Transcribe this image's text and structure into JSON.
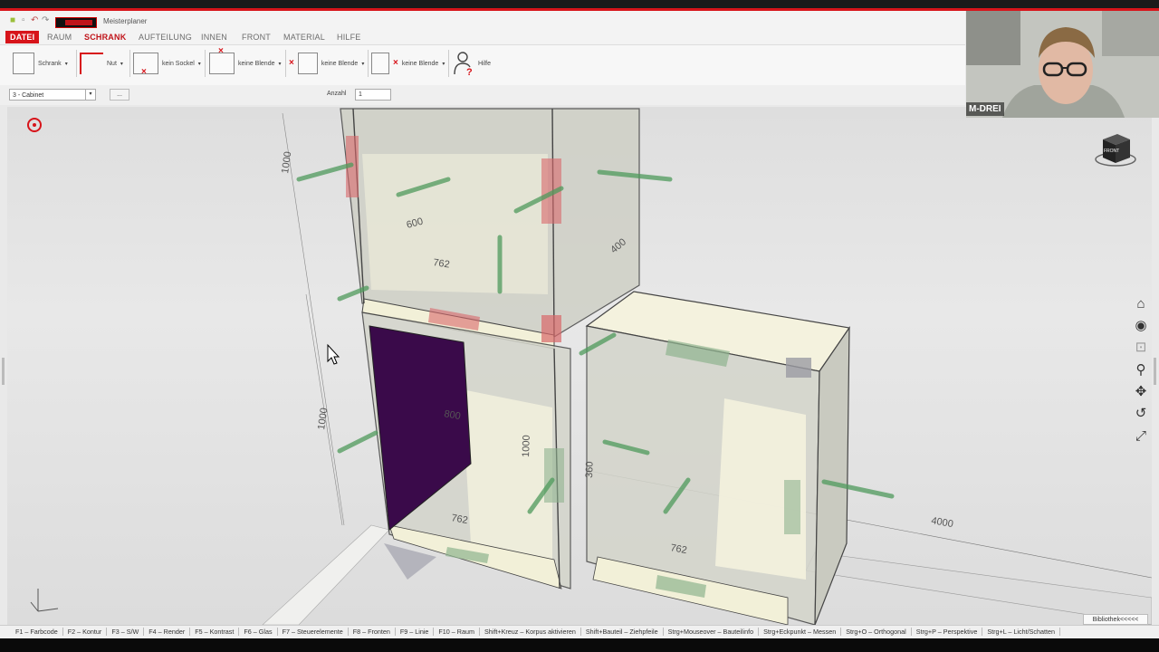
{
  "app": {
    "title": "Meisterplaner"
  },
  "menu": {
    "items": [
      "DATEI",
      "RAUM",
      "SCHRANK",
      "AUFTEILUNG",
      "INNEN",
      "FRONT",
      "MATERIAL",
      "HILFE"
    ],
    "active": "SCHRANK"
  },
  "ribbon": {
    "schrank": "Schrank",
    "nut": "Nut",
    "sockel": "kein Sockel",
    "blende1": "keine Blende",
    "blende2": "keine Blende",
    "blende3": "keine Blende",
    "hilfe": "Hilfe"
  },
  "subbar": {
    "cabinet_value": "3 - Cabinet",
    "more_label": "...",
    "anzahl_label": "Anzahl",
    "anzahl_value": "1"
  },
  "viewport": {
    "dimensions": {
      "d1000_top": "1000",
      "d600": "600",
      "d762_top": "762",
      "d400": "400",
      "d1000_left": "1000",
      "d800": "800",
      "d1000_mid": "1000",
      "d762_bottom": "762",
      "d360": "360",
      "d762_right": "762",
      "d4000": "4000"
    },
    "nav_cube_label": "FRONT"
  },
  "webcam": {
    "name": "M-DREI"
  },
  "statusbar": {
    "shortcuts": [
      "F1 – Farbcode",
      "F2 – Kontur",
      "F3 – S/W",
      "F4 – Render",
      "F5 – Kontrast",
      "F6 – Glas",
      "F7 – Steuerelemente",
      "F8 – Fronten",
      "F9 – Linie",
      "F10 – Raum",
      "Shift+Kreuz – Korpus aktivieren",
      "Shift+Bauteil – Ziehpfeile",
      "Strg+Mouseover – Bauteilinfo",
      "Strg+Eckpunkt – Messen",
      "Strg+O – Orthogonal",
      "Strg+P – Perspektive",
      "Strg+L – Licht/Schatten"
    ],
    "library_tab": "Bibliothek<<<<<"
  },
  "colors": {
    "accent": "#d7141a",
    "front_panel": "#3a0a4a",
    "panel_face": "#f4f2de",
    "arrow_green": "#4f9a5c",
    "edge_red": "#d9686a"
  },
  "icons": [
    "eye-icon",
    "home-icon",
    "orbit-icon",
    "zoom-window-icon",
    "zoom-icon",
    "pan-icon",
    "undo-view-icon",
    "fullscreen-icon"
  ]
}
